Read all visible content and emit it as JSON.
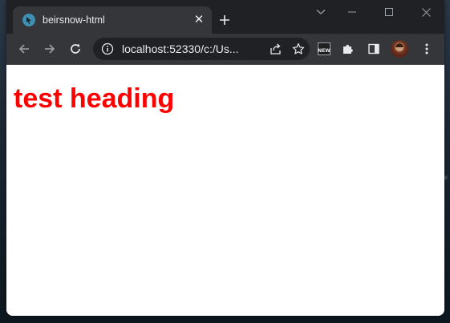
{
  "tab": {
    "title": "beirsnow-html",
    "close_glyph": "✕",
    "favicon": "favicon-icon"
  },
  "omnibox": {
    "url": "localhost:52330/c:/Us..."
  },
  "extensions": {
    "new_badge_label": "NEW"
  },
  "page": {
    "heading": "test heading"
  },
  "colors": {
    "heading": "#ff0000",
    "chrome_dark": "#202124",
    "chrome_tab": "#35363a"
  }
}
